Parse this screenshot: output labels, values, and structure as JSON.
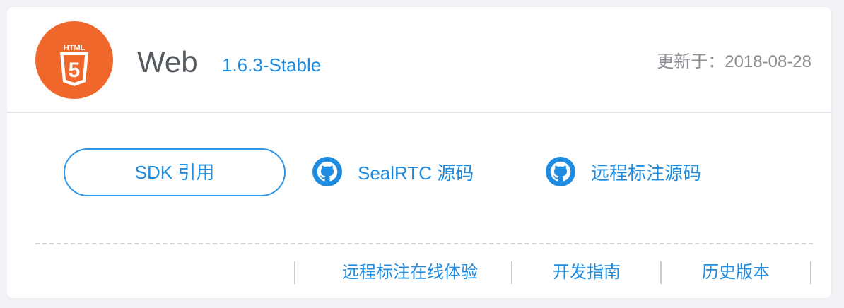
{
  "header": {
    "logo_text": "HTML",
    "logo_digit": "5",
    "title": "Web",
    "version": "1.6.3-Stable",
    "updated_label": "更新于：",
    "updated_date": "2018-08-28"
  },
  "actions": {
    "sdk_button_label": "SDK 引用",
    "sealrtc_link_label": "SealRTC 源码",
    "remote_link_label": "远程标注源码"
  },
  "footer": {
    "links": [
      {
        "label": "远程标注在线体验"
      },
      {
        "label": "开发指南"
      },
      {
        "label": "历史版本"
      }
    ]
  },
  "colors": {
    "accent": "#1e8ce0",
    "logo_bg": "#f0672b",
    "title": "#555a60",
    "muted": "#8a8e93"
  },
  "icons": {
    "logo": "html5-logo-icon",
    "github": "github-icon"
  }
}
